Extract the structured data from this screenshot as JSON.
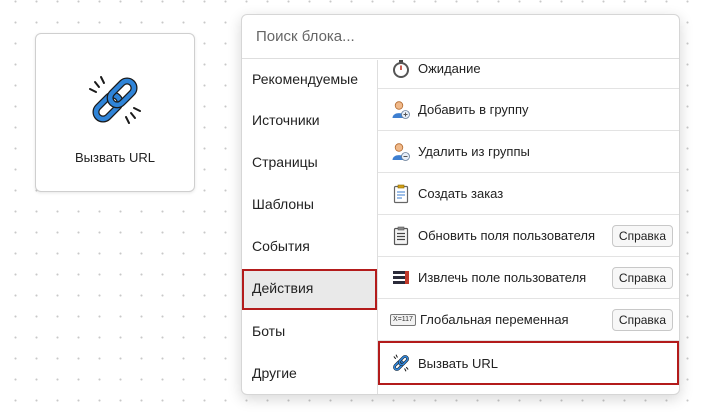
{
  "node": {
    "label": "Вызвать URL",
    "icon": "link-icon"
  },
  "search": {
    "placeholder": "Поиск блока..."
  },
  "categories": [
    {
      "label": "Рекомендуемые"
    },
    {
      "label": "Источники"
    },
    {
      "label": "Страницы"
    },
    {
      "label": "Шаблоны"
    },
    {
      "label": "События"
    },
    {
      "label": "Действия",
      "active": true
    },
    {
      "label": "Боты"
    },
    {
      "label": "Другие"
    }
  ],
  "blocks": [
    {
      "label": "Ожидание",
      "icon": "stopwatch-icon"
    },
    {
      "label": "Добавить в группу",
      "icon": "user-add-icon"
    },
    {
      "label": "Удалить из группы",
      "icon": "user-remove-icon"
    },
    {
      "label": "Создать заказ",
      "icon": "clipboard-icon"
    },
    {
      "label": "Обновить поля пользователя",
      "icon": "clipboard-list-icon",
      "help": "Справка"
    },
    {
      "label": "Извлечь поле пользователя",
      "icon": "list-icon",
      "help": "Справка"
    },
    {
      "label": "Глобальная переменная",
      "icon": "variable-icon",
      "badge": "X=117",
      "help": "Справка"
    },
    {
      "label": "Вызвать URL",
      "icon": "link-icon",
      "highlighted": true
    }
  ],
  "colors": {
    "accent_blue": "#2f84d8",
    "highlight_red": "#b31b1b",
    "active_bg": "#e9e9e9"
  }
}
